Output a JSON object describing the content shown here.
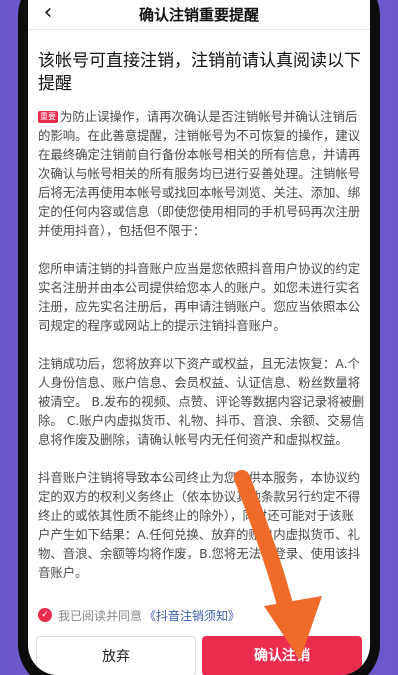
{
  "header": {
    "back_icon": "chevron-left-icon",
    "title": "确认注销重要提醒"
  },
  "headline": "该帐号可直接注销，注销前请认真阅读以下提醒",
  "badge": "重要",
  "paragraphs": [
    "为防止误操作，请再次确认是否注销帐号并确认注销后的影响。在此善意提醒，注销帐号为不可恢复的操作，建议在最终确定注销前自行备份本帐号相关的所有信息，并请再次确认与帐号相关的所有服务均已进行妥善处理。注销帐号后将无法再使用本帐号或找回本帐号浏览、关注、添加、绑定的任何内容或信息（即使您使用相同的手机号码再次注册并使用抖音），包括但不限于：",
    "您所申请注销的抖音账户应当是您依照抖音用户协议的约定实名注册并由本公司提供给您本人的账户。如您未进行实名注册，应先实名注册后，再申请注销账户。您应当依照本公司规定的程序或网站上的提示注销抖音账户。",
    "注销成功后，您将放弃以下资产或权益，且无法恢复：A.个人身份信息、账户信息、会员权益、认证信息、粉丝数量将被清空。 B.发布的视频、点赞、评论等数据内容记录将被删除。 C.账户内虚拟货币、礼物、抖币、音浪、余额、交易信息将作废及删除，请确认帐号内无任何资产和虚拟权益。",
    "抖音账户注销将导致本公司终止为您提供本服务，本协议约定的双方的权利义务终止（依本协议其他条款另行约定不得终止的或依其性质不能终止的除外），同时还可能对于该账户产生如下结果：A.任何兑换、放弃的账户内虚拟货币、礼物、音浪、余额等均将作废，B.您将无法再登录、使用该抖音账户。"
  ],
  "agreement": {
    "text": "我已阅读并同意",
    "link": "《抖音注销须知》",
    "checked": true
  },
  "buttons": {
    "cancel": "放弃",
    "confirm": "确认注销"
  },
  "colors": {
    "accent": "#ea2c4f",
    "link": "#3a5aa8",
    "arrow": "#f06a2a"
  }
}
